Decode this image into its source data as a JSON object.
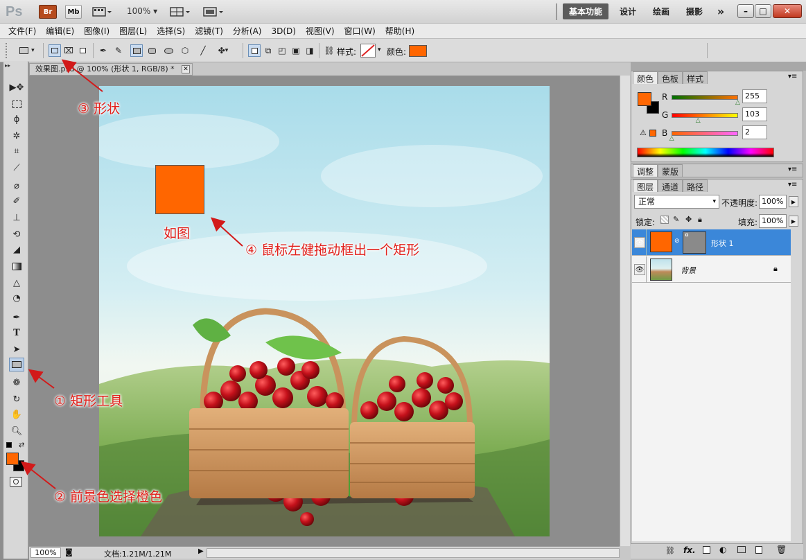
{
  "titlebar": {
    "app_icon": "Ps",
    "br": "Br",
    "mb": "Mb",
    "zoom": "100%",
    "workspaces": [
      "基本功能",
      "设计",
      "绘画",
      "摄影"
    ],
    "more": "»",
    "win_min": "–",
    "win_max": "□",
    "win_close": "✕"
  },
  "menu": [
    "文件(F)",
    "编辑(E)",
    "图像(I)",
    "图层(L)",
    "选择(S)",
    "滤镜(T)",
    "分析(A)",
    "3D(D)",
    "视图(V)",
    "窗口(W)",
    "帮助(H)"
  ],
  "options": {
    "style_label": "样式:",
    "color_label": "颜色:",
    "color": "#ff6600"
  },
  "document": {
    "tab_title": "效果图.psd @ 100% (形状 1, RGB/8) *",
    "zoom": "100%",
    "doc_size": "文档:1.21M/1.21M"
  },
  "color_panel": {
    "tabs": [
      "颜色",
      "色板",
      "样式"
    ],
    "r_label": "R",
    "g_label": "G",
    "b_label": "B",
    "r": "255",
    "g": "103",
    "b": "2",
    "r_level": 1.0,
    "g_level": 0.404,
    "b_level": 0.008,
    "foreground": "#ff6702",
    "background": "#000000"
  },
  "adjust_panel": {
    "tabs": [
      "调整",
      "蒙版"
    ]
  },
  "layers_panel": {
    "tabs": [
      "图层",
      "通道",
      "路径"
    ],
    "blend_mode": "正常",
    "opacity_label": "不透明度:",
    "opacity": "100%",
    "lock_label": "锁定:",
    "fill_label": "填充:",
    "fill": "100%",
    "layers": [
      {
        "name": "形状 1",
        "selected": true
      },
      {
        "name": "背景",
        "selected": false
      }
    ]
  },
  "annotations": {
    "step1": "① 矩形工具",
    "step2": "② 前景色选择橙色",
    "step3": "③ 形状",
    "step4": "④ 鼠标左健拖动框出一个矩形",
    "example": "如图"
  }
}
